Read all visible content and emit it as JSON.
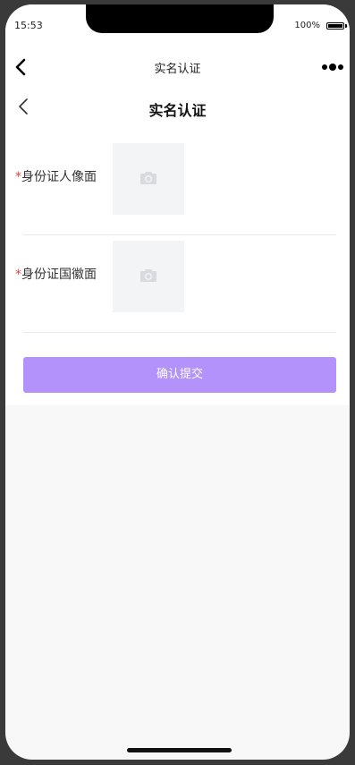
{
  "status_bar": {
    "time": "15:53",
    "battery_text": "100%"
  },
  "nav_bar": {
    "title": "实名认证",
    "back_icon": "chevron-left-icon",
    "more_icon": "more-dots-icon"
  },
  "page_header": {
    "title": "实名认证",
    "back_icon": "chevron-left-icon"
  },
  "form": {
    "fields": [
      {
        "required_mark": "*",
        "label": "身份证人像面",
        "upload_icon": "camera-icon"
      },
      {
        "required_mark": "*",
        "label": "身份证国徽面",
        "upload_icon": "camera-icon"
      }
    ],
    "submit_label": "确认提交"
  },
  "colors": {
    "primary": "#b392fb",
    "required": "#e64340",
    "upload_bg": "#f3f4f6",
    "page_bg": "#f8f8f8"
  }
}
